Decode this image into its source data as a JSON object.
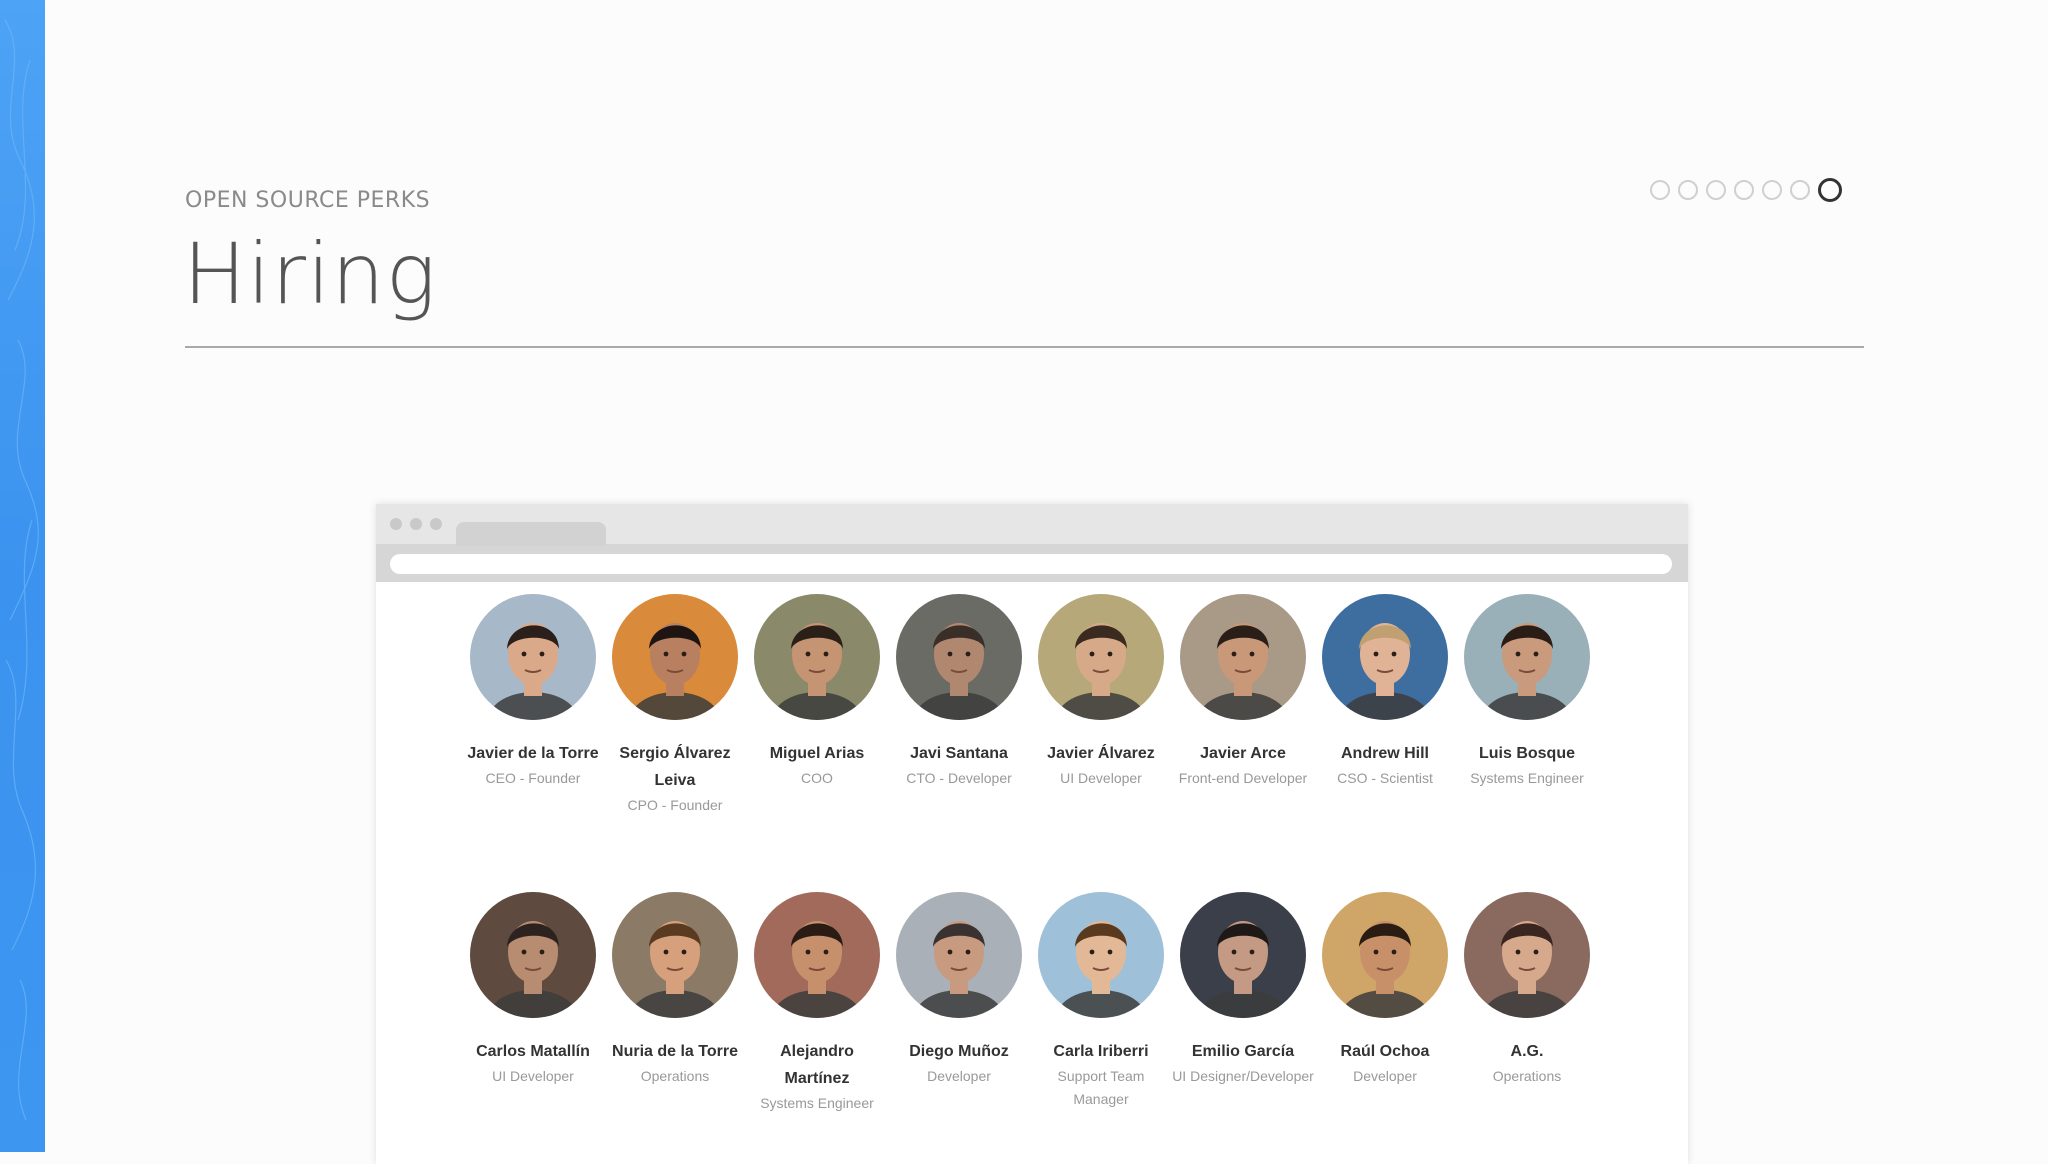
{
  "header": {
    "kicker": "OPEN SOURCE PERKS",
    "title": "Hiring"
  },
  "pager": {
    "count": 7,
    "active_index": 6
  },
  "colors": {
    "accent_stripe": "#3d96f0",
    "rule": "#a9a9a9"
  },
  "team": [
    {
      "name": "Javier de la Torre",
      "role": "CEO - Founder",
      "skin": "#d9a98a",
      "hair": "#2a1f1a",
      "bg": "#a7b8c9"
    },
    {
      "name": "Sergio Álvarez Leiva",
      "role": "CPO - Founder",
      "skin": "#b88060",
      "hair": "#1e1512",
      "bg": "#d98a3a"
    },
    {
      "name": "Miguel Arias",
      "role": "COO",
      "skin": "#c49473",
      "hair": "#2a2018",
      "bg": "#8a8a6a"
    },
    {
      "name": "Javi Santana",
      "role": "CTO - Developer",
      "skin": "#b08870",
      "hair": "#3a2e28",
      "bg": "#6b6b66"
    },
    {
      "name": "Javier Álvarez",
      "role": "UI Developer",
      "skin": "#d6aa88",
      "hair": "#3a2a20",
      "bg": "#b6a878"
    },
    {
      "name": "Javier Arce",
      "role": "Front-end Developer",
      "skin": "#c89878",
      "hair": "#2a1e18",
      "bg": "#a99a88"
    },
    {
      "name": "Andrew Hill",
      "role": "CSO - Scientist",
      "skin": "#e0b296",
      "hair": "#c0a070",
      "bg": "#3e6da0"
    },
    {
      "name": "Luis Bosque",
      "role": "Systems Engineer",
      "skin": "#c99a7c",
      "hair": "#2a1d16",
      "bg": "#9ab0b8"
    },
    {
      "name": "Carlos Matallín",
      "role": "UI Developer",
      "skin": "#b88c70",
      "hair": "#2c2220",
      "bg": "#5e4a3e"
    },
    {
      "name": "Nuria de la Torre",
      "role": "Operations",
      "skin": "#d6a07c",
      "hair": "#5a3a20",
      "bg": "#8a7a66"
    },
    {
      "name": "Alejandro Martínez",
      "role": "Systems Engineer",
      "skin": "#c6906c",
      "hair": "#2a1c14",
      "bg": "#a26a5a"
    },
    {
      "name": "Diego Muñoz",
      "role": "Developer",
      "skin": "#c89a80",
      "hair": "#3a3230",
      "bg": "#a9b0b8"
    },
    {
      "name": "Carla Iriberri",
      "role": "Support Team Manager",
      "skin": "#e2b896",
      "hair": "#5a3a1e",
      "bg": "#9ec0d8"
    },
    {
      "name": "Emilio García",
      "role": "UI Designer/Developer",
      "skin": "#c49a84",
      "hair": "#1e1816",
      "bg": "#3a3f4a"
    },
    {
      "name": "Raúl Ochoa",
      "role": "Developer",
      "skin": "#c89068",
      "hair": "#2a1c12",
      "bg": "#d0a668"
    },
    {
      "name": "A.G.",
      "role": "Operations",
      "skin": "#d6a88c",
      "hair": "#3a2620",
      "bg": "#8a6a5e"
    }
  ]
}
